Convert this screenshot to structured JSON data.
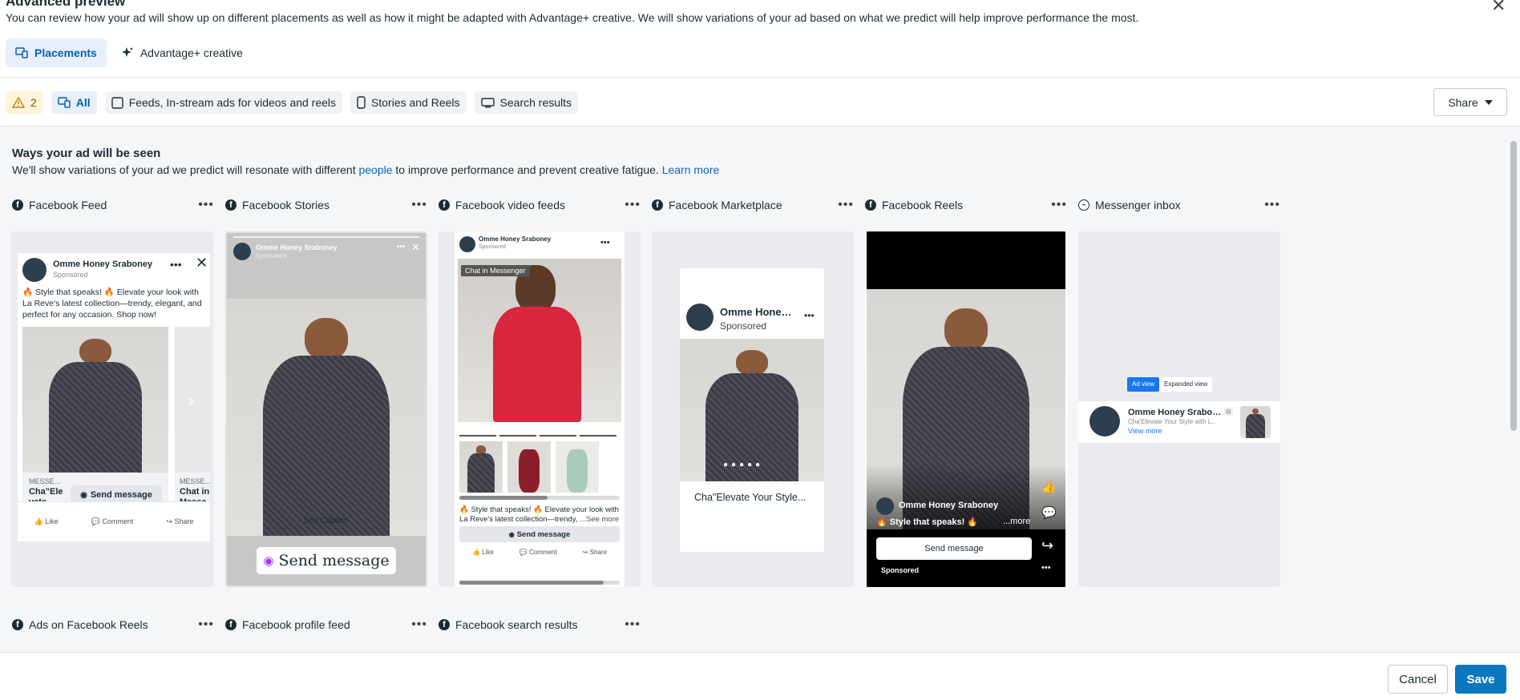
{
  "header": {
    "title": "Advanced preview",
    "subtitle": "You can review how your ad will show up on different placements as well as how it might be adapted with Advantage+ creative. We will show variations of your ad based on what we predict will help improve performance the most.",
    "close_glyph": "✕"
  },
  "tabs": [
    {
      "label": "Placements",
      "active": true
    },
    {
      "label": "Advantage+ creative",
      "active": false
    }
  ],
  "filters": {
    "warning_count": "2",
    "items": [
      {
        "label": "All",
        "active": true
      },
      {
        "label": "Feeds, In-stream ads for videos and reels"
      },
      {
        "label": "Stories and Reels"
      },
      {
        "label": "Search results"
      }
    ]
  },
  "share_label": "Share",
  "section": {
    "title": "Ways your ad will be seen",
    "subtitle_pre": "We'll show variations of your ad we predict will resonate with different ",
    "people_link": "people",
    "subtitle_mid": " to improve performance and prevent creative fatigue. ",
    "learn_more": "Learn more"
  },
  "placements": [
    {
      "label": "Facebook Feed"
    },
    {
      "label": "Facebook Stories"
    },
    {
      "label": "Facebook video feeds"
    },
    {
      "label": "Facebook Marketplace"
    },
    {
      "label": "Facebook Reels"
    },
    {
      "label": "Messenger inbox"
    }
  ],
  "placements_row2": [
    {
      "label": "Ads on Facebook Reels"
    },
    {
      "label": "Facebook profile feed"
    },
    {
      "label": "Facebook search results"
    }
  ],
  "ad": {
    "page_name": "Omme Honey Sraboney",
    "page_name_short": "Omme Hone…",
    "page_name_short2": "Omme Honey Srabo…",
    "sponsored": "Sponsored",
    "caption": "🔥 Style that speaks! 🔥 Elevate your look with La Reve's latest collection—trendy, elegant, and perfect for any occasion. Shop now!",
    "caption_short": "🔥 Style that speaks! 🔥 Elevate your look with La Reve's latest collection—trendy,",
    "see_more": "...See more",
    "feed_card1_tag": "MESSE...",
    "feed_card1_title": "Cha\"Ele vate...",
    "feed_card2_tag": "MESSE...",
    "feed_card2_title": "Chat in Messe...",
    "send_message": "Send message",
    "like": "Like",
    "comment": "Comment",
    "share": "Share",
    "see_caption": "See Caption",
    "chat_in_messenger": "Chat in Messenger",
    "marketplace_title": "Cha\"Elevate Your Style...",
    "reels_caption": "🔥 Style that speaks! 🔥",
    "reels_more": "...more",
    "messenger_ad_view": "Ad view",
    "messenger_expanded": "Expanded view",
    "messenger_line": "Cha'Elevate Your Style with L...",
    "view_more": "View more"
  },
  "footer": {
    "cancel": "Cancel",
    "save": "Save"
  }
}
